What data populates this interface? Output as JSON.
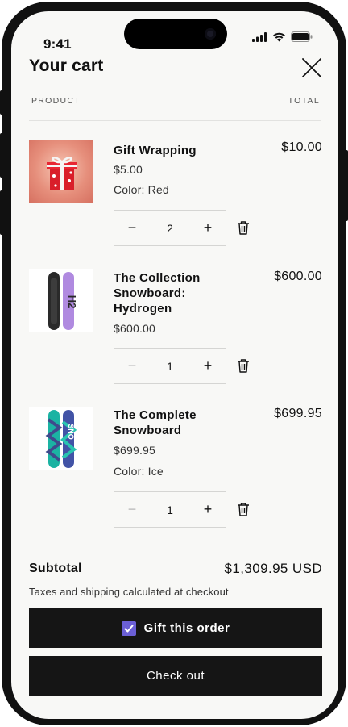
{
  "status_bar": {
    "time": "9:41"
  },
  "header": {
    "title": "Your cart",
    "close_icon": "close-icon"
  },
  "columns": {
    "product": "PRODUCT",
    "total": "TOTAL"
  },
  "items": [
    {
      "name": "Gift Wrapping",
      "price": "$5.00",
      "option": "Color: Red",
      "quantity": "2",
      "total": "$10.00",
      "decrease_enabled": true
    },
    {
      "name": "The Collection Snowboard: Hydrogen",
      "price": "$600.00",
      "option": "",
      "quantity": "1",
      "total": "$600.00",
      "decrease_enabled": false
    },
    {
      "name": "The Complete Snowboard",
      "price": "$699.95",
      "option": "Color: Ice",
      "quantity": "1",
      "total": "$699.95",
      "decrease_enabled": false
    }
  ],
  "qty_controls": {
    "minus": "−",
    "plus": "+"
  },
  "summary": {
    "subtotal_label": "Subtotal",
    "subtotal_value": "$1,309.95 USD",
    "tax_note": "Taxes and shipping calculated at checkout"
  },
  "actions": {
    "gift_label": "Gift this order",
    "gift_checked": true,
    "checkout_label": "Check out"
  },
  "colors": {
    "button_bg": "#151515",
    "checkbox": "#6b5fd6",
    "screen_bg": "#f8f8f6"
  }
}
